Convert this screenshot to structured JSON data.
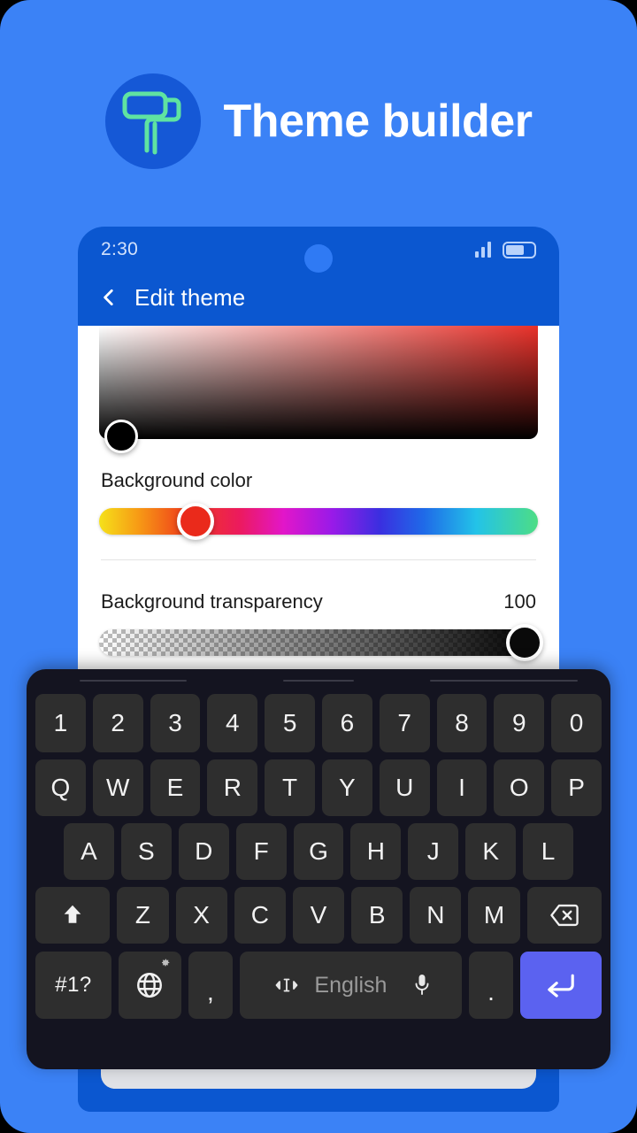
{
  "promo": {
    "title": "Theme builder",
    "logo_icon": "paint-roller-icon",
    "background_color": "#3b82f6",
    "badge_color": "#1558d6",
    "logo_stroke_color": "#5fe3a1"
  },
  "phone": {
    "status": {
      "time": "2:30",
      "signal_icon": "signal-bars-icon",
      "battery_icon": "battery-icon",
      "punch_hole": "camera-punch-hole"
    },
    "appbar": {
      "back_icon": "back-chevron-icon",
      "title": "Edit theme"
    },
    "color_picker": {
      "sv_thumb_color": "#000000",
      "hue_label": "Background color",
      "hue_thumb_color": "#ea2a1b",
      "hue_thumb_position_pct": 22,
      "alpha_label": "Background transparency",
      "alpha_value": "100",
      "alpha_thumb_color": "#0a0a0a",
      "alpha_thumb_position_pct": 97
    }
  },
  "keyboard": {
    "accent_color": "#5b62f0",
    "key_color": "#2e2e2e",
    "rows": {
      "numbers": [
        "1",
        "2",
        "3",
        "4",
        "5",
        "6",
        "7",
        "8",
        "9",
        "0"
      ],
      "top": [
        "Q",
        "W",
        "E",
        "R",
        "T",
        "Y",
        "U",
        "I",
        "O",
        "P"
      ],
      "home": [
        "A",
        "S",
        "D",
        "F",
        "G",
        "H",
        "J",
        "K",
        "L"
      ],
      "bottom": [
        "Z",
        "X",
        "C",
        "V",
        "B",
        "N",
        "M"
      ]
    },
    "shift_icon": "shift-up-arrow-icon",
    "backspace_icon": "backspace-delete-icon",
    "symbols_label": "#1?",
    "globe_icon": "globe-language-icon",
    "gear_icon": "gear-settings-icon",
    "comma_label": ",",
    "cursor_icon": "cursor-move-icon",
    "space_label": "English",
    "mic_icon": "microphone-icon",
    "period_label": ".",
    "enter_icon": "enter-return-icon"
  }
}
